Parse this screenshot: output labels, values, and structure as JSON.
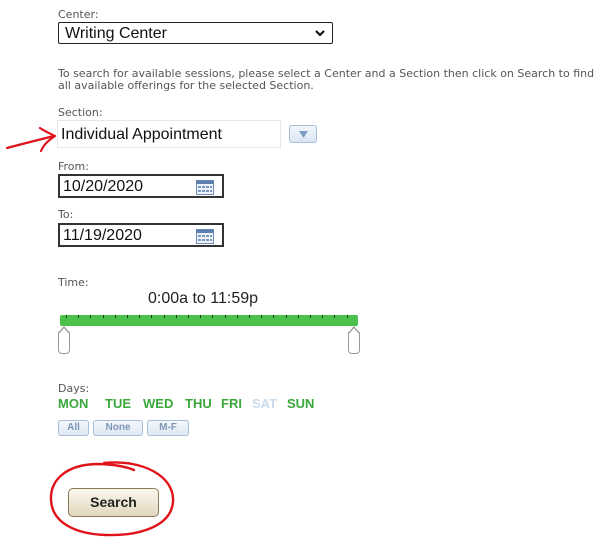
{
  "center": {
    "label": "Center:",
    "selected": "Writing Center"
  },
  "help_text": "To search for available sessions, please select a Center and a Section then click on Search to find all available offerings for the selected Section.",
  "section": {
    "label": "Section:",
    "value": "Individual Appointment"
  },
  "from": {
    "label": "From:",
    "value": "10/20/2020"
  },
  "to": {
    "label": "To:",
    "value": "11/19/2020"
  },
  "time": {
    "label": "Time:",
    "value": "0:00a to 11:59p",
    "range_start_fraction": 0.0,
    "range_end_fraction": 1.0
  },
  "days": {
    "label": "Days:",
    "items": [
      {
        "label": "MON",
        "active": true
      },
      {
        "label": "TUE",
        "active": true
      },
      {
        "label": "WED",
        "active": true
      },
      {
        "label": "THU",
        "active": true
      },
      {
        "label": "FRI",
        "active": true
      },
      {
        "label": "SAT",
        "active": false
      },
      {
        "label": "SUN",
        "active": true
      }
    ],
    "buttons": {
      "all": "All",
      "none": "None",
      "weekdays": "M-F"
    }
  },
  "search_label": "Search",
  "colors": {
    "annotation": "#e0131b",
    "slider": "#4cc14c",
    "day_active": "#3aa83a",
    "day_inactive": "#c8dced"
  }
}
